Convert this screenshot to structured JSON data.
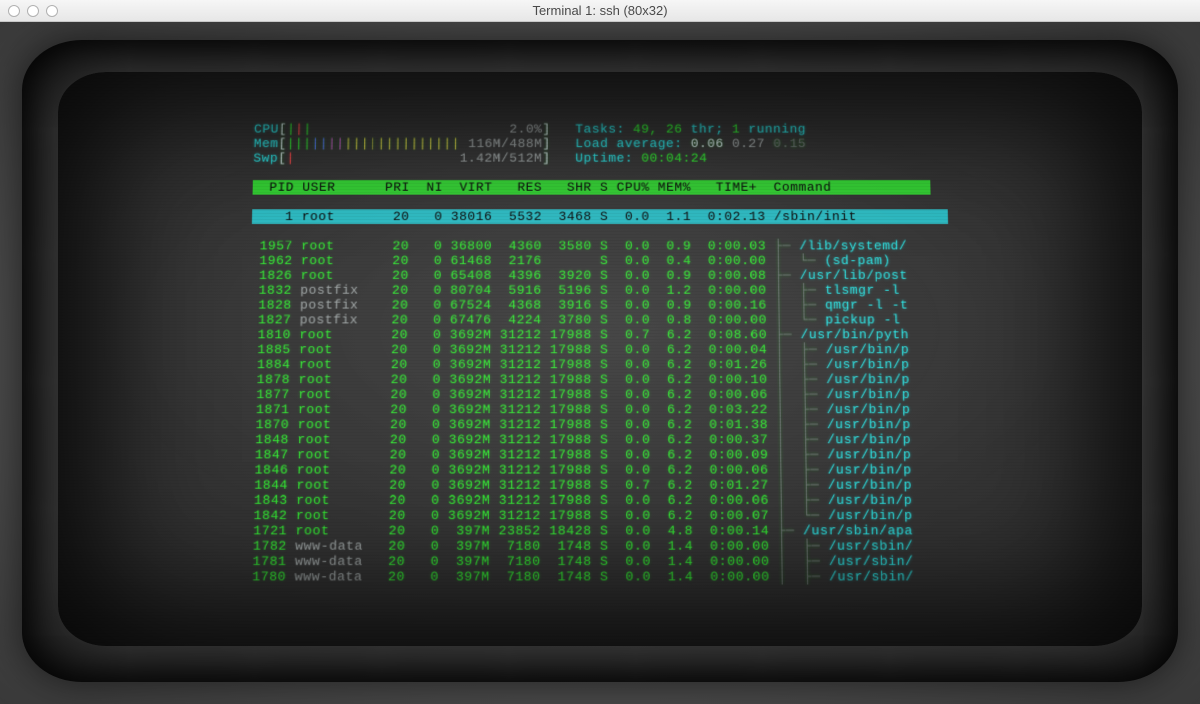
{
  "window": {
    "title": "Terminal 1: ssh (80x32)"
  },
  "meters": {
    "cpu": {
      "label": "CPU",
      "value": "2.0%"
    },
    "mem": {
      "label": "Mem",
      "value": "116M/488M"
    },
    "swp": {
      "label": "Swp",
      "value": "1.42M/512M"
    }
  },
  "summary": {
    "tasks_label": "Tasks:",
    "tasks_total": "49,",
    "tasks_thr": "26",
    "tasks_thr_suffix": "thr;",
    "tasks_running": "1",
    "tasks_running_suffix": "running",
    "load_label": "Load average:",
    "load1": "0.06",
    "load5": "0.27",
    "load15": "0.15",
    "uptime_label": "Uptime:",
    "uptime": "00:04:24"
  },
  "columns": "  PID USER      PRI  NI  VIRT   RES   SHR S CPU% MEM%   TIME+  Command            ",
  "selected": {
    "pid": "1",
    "user": "root",
    "pri": "20",
    "ni": "0",
    "virt": "38016",
    "res": "5532",
    "shr": "3468",
    "s": "S",
    "cpu": "0.0",
    "mem": "1.1",
    "time": "0:02.13",
    "cmd": "/sbin/init"
  },
  "rows": [
    {
      "pid": "1957",
      "user": "root",
      "pri": "20",
      "ni": "0",
      "virt": "36800",
      "res": "4360",
      "shr": "3580",
      "s": "S",
      "cpu": "0.0",
      "mem": "0.9",
      "time": "0:00.03",
      "tree": "├─ ",
      "cmd": "/lib/systemd/"
    },
    {
      "pid": "1962",
      "user": "root",
      "pri": "20",
      "ni": "0",
      "virt": "61468",
      "res": "2176",
      "shr": "",
      "s": "S",
      "cpu": "0.0",
      "mem": "0.4",
      "time": "0:00.00",
      "tree": "│  └─ ",
      "cmd": "(sd-pam)"
    },
    {
      "pid": "1826",
      "user": "root",
      "pri": "20",
      "ni": "0",
      "virt": "65408",
      "res": "4396",
      "shr": "3920",
      "s": "S",
      "cpu": "0.0",
      "mem": "0.9",
      "time": "0:00.08",
      "tree": "├─ ",
      "cmd": "/usr/lib/post"
    },
    {
      "pid": "1832",
      "user": "postfix",
      "pri": "20",
      "ni": "0",
      "virt": "80704",
      "res": "5916",
      "shr": "5196",
      "s": "S",
      "cpu": "0.0",
      "mem": "1.2",
      "time": "0:00.00",
      "tree": "│  ├─ ",
      "cmd": "tlsmgr -l"
    },
    {
      "pid": "1828",
      "user": "postfix",
      "pri": "20",
      "ni": "0",
      "virt": "67524",
      "res": "4368",
      "shr": "3916",
      "s": "S",
      "cpu": "0.0",
      "mem": "0.9",
      "time": "0:00.16",
      "tree": "│  ├─ ",
      "cmd": "qmgr -l -t"
    },
    {
      "pid": "1827",
      "user": "postfix",
      "pri": "20",
      "ni": "0",
      "virt": "67476",
      "res": "4224",
      "shr": "3780",
      "s": "S",
      "cpu": "0.0",
      "mem": "0.8",
      "time": "0:00.00",
      "tree": "│  └─ ",
      "cmd": "pickup -l"
    },
    {
      "pid": "1810",
      "user": "root",
      "pri": "20",
      "ni": "0",
      "virt": "3692M",
      "res": "31212",
      "shr": "17988",
      "s": "S",
      "cpu": "0.7",
      "mem": "6.2",
      "time": "0:08.60",
      "tree": "├─ ",
      "cmd": "/usr/bin/pyth"
    },
    {
      "pid": "1885",
      "user": "root",
      "pri": "20",
      "ni": "0",
      "virt": "3692M",
      "res": "31212",
      "shr": "17988",
      "s": "S",
      "cpu": "0.0",
      "mem": "6.2",
      "time": "0:00.04",
      "tree": "│  ├─ ",
      "cmd": "/usr/bin/p"
    },
    {
      "pid": "1884",
      "user": "root",
      "pri": "20",
      "ni": "0",
      "virt": "3692M",
      "res": "31212",
      "shr": "17988",
      "s": "S",
      "cpu": "0.0",
      "mem": "6.2",
      "time": "0:01.26",
      "tree": "│  ├─ ",
      "cmd": "/usr/bin/p"
    },
    {
      "pid": "1878",
      "user": "root",
      "pri": "20",
      "ni": "0",
      "virt": "3692M",
      "res": "31212",
      "shr": "17988",
      "s": "S",
      "cpu": "0.0",
      "mem": "6.2",
      "time": "0:00.10",
      "tree": "│  ├─ ",
      "cmd": "/usr/bin/p"
    },
    {
      "pid": "1877",
      "user": "root",
      "pri": "20",
      "ni": "0",
      "virt": "3692M",
      "res": "31212",
      "shr": "17988",
      "s": "S",
      "cpu": "0.0",
      "mem": "6.2",
      "time": "0:00.06",
      "tree": "│  ├─ ",
      "cmd": "/usr/bin/p"
    },
    {
      "pid": "1871",
      "user": "root",
      "pri": "20",
      "ni": "0",
      "virt": "3692M",
      "res": "31212",
      "shr": "17988",
      "s": "S",
      "cpu": "0.0",
      "mem": "6.2",
      "time": "0:03.22",
      "tree": "│  ├─ ",
      "cmd": "/usr/bin/p"
    },
    {
      "pid": "1870",
      "user": "root",
      "pri": "20",
      "ni": "0",
      "virt": "3692M",
      "res": "31212",
      "shr": "17988",
      "s": "S",
      "cpu": "0.0",
      "mem": "6.2",
      "time": "0:01.38",
      "tree": "│  ├─ ",
      "cmd": "/usr/bin/p"
    },
    {
      "pid": "1848",
      "user": "root",
      "pri": "20",
      "ni": "0",
      "virt": "3692M",
      "res": "31212",
      "shr": "17988",
      "s": "S",
      "cpu": "0.0",
      "mem": "6.2",
      "time": "0:00.37",
      "tree": "│  ├─ ",
      "cmd": "/usr/bin/p"
    },
    {
      "pid": "1847",
      "user": "root",
      "pri": "20",
      "ni": "0",
      "virt": "3692M",
      "res": "31212",
      "shr": "17988",
      "s": "S",
      "cpu": "0.0",
      "mem": "6.2",
      "time": "0:00.09",
      "tree": "│  ├─ ",
      "cmd": "/usr/bin/p"
    },
    {
      "pid": "1846",
      "user": "root",
      "pri": "20",
      "ni": "0",
      "virt": "3692M",
      "res": "31212",
      "shr": "17988",
      "s": "S",
      "cpu": "0.0",
      "mem": "6.2",
      "time": "0:00.06",
      "tree": "│  ├─ ",
      "cmd": "/usr/bin/p"
    },
    {
      "pid": "1844",
      "user": "root",
      "pri": "20",
      "ni": "0",
      "virt": "3692M",
      "res": "31212",
      "shr": "17988",
      "s": "S",
      "cpu": "0.7",
      "mem": "6.2",
      "time": "0:01.27",
      "tree": "│  ├─ ",
      "cmd": "/usr/bin/p"
    },
    {
      "pid": "1843",
      "user": "root",
      "pri": "20",
      "ni": "0",
      "virt": "3692M",
      "res": "31212",
      "shr": "17988",
      "s": "S",
      "cpu": "0.0",
      "mem": "6.2",
      "time": "0:00.06",
      "tree": "│  ├─ ",
      "cmd": "/usr/bin/p"
    },
    {
      "pid": "1842",
      "user": "root",
      "pri": "20",
      "ni": "0",
      "virt": "3692M",
      "res": "31212",
      "shr": "17988",
      "s": "S",
      "cpu": "0.0",
      "mem": "6.2",
      "time": "0:00.07",
      "tree": "│  └─ ",
      "cmd": "/usr/bin/p"
    },
    {
      "pid": "1721",
      "user": "root",
      "pri": "20",
      "ni": "0",
      "virt": "397M",
      "res": "23852",
      "shr": "18428",
      "s": "S",
      "cpu": "0.0",
      "mem": "4.8",
      "time": "0:00.14",
      "tree": "├─ ",
      "cmd": "/usr/sbin/apa"
    },
    {
      "pid": "1782",
      "user": "www-data",
      "pri": "20",
      "ni": "0",
      "virt": "397M",
      "res": "7180",
      "shr": "1748",
      "s": "S",
      "cpu": "0.0",
      "mem": "1.4",
      "time": "0:00.00",
      "tree": "│  ├─ ",
      "cmd": "/usr/sbin/"
    },
    {
      "pid": "1781",
      "user": "www-data",
      "pri": "20",
      "ni": "0",
      "virt": "397M",
      "res": "7180",
      "shr": "1748",
      "s": "S",
      "cpu": "0.0",
      "mem": "1.4",
      "time": "0:00.00",
      "tree": "│  ├─ ",
      "cmd": "/usr/sbin/"
    },
    {
      "pid": "1780",
      "user": "www-data",
      "pri": "20",
      "ni": "0",
      "virt": "397M",
      "res": "7180",
      "shr": "1748",
      "s": "S",
      "cpu": "0.0",
      "mem": "1.4",
      "time": "0:00.00",
      "tree": "│  ├─ ",
      "cmd": "/usr/sbin/"
    }
  ]
}
